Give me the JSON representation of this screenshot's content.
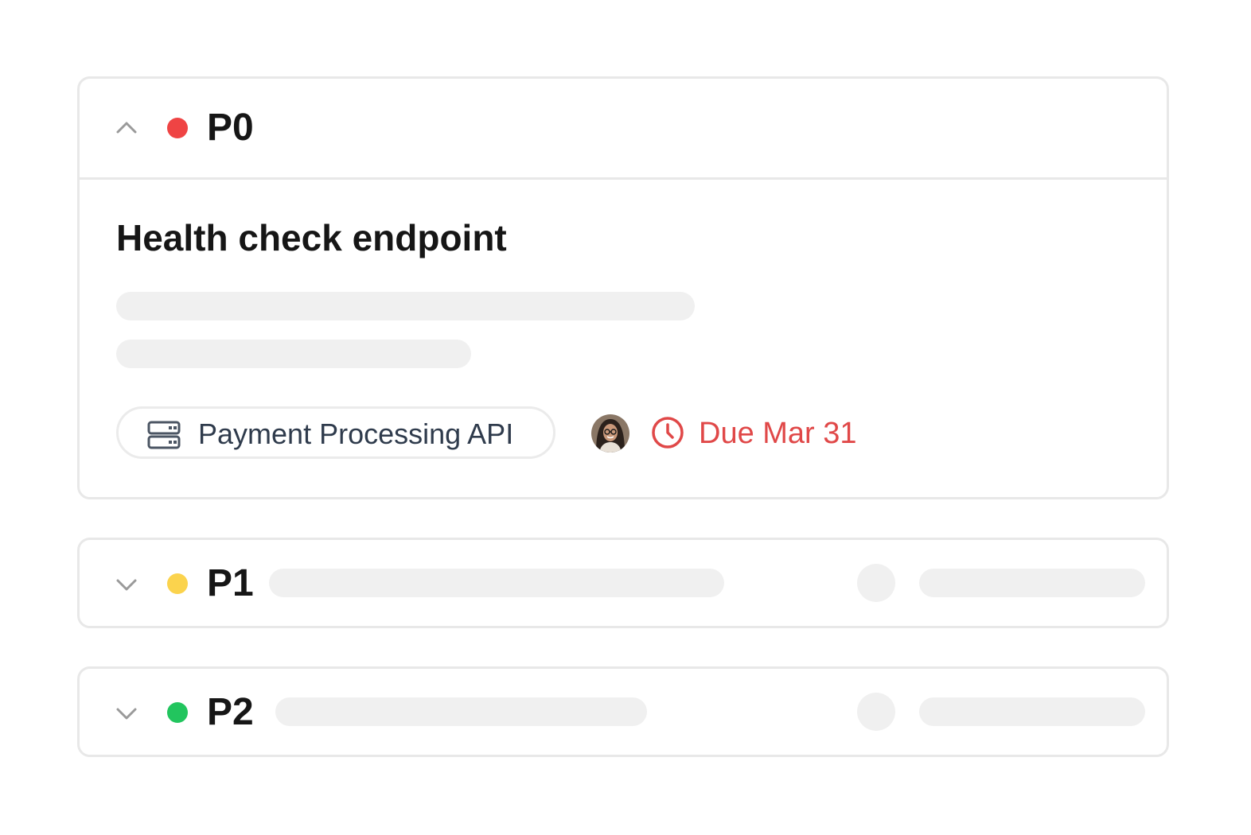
{
  "groups": [
    {
      "priority": "P0",
      "expanded": true,
      "dot_color": "#ef4444",
      "chevron_icon": "chevron-up-icon",
      "task": {
        "title": "Health check endpoint",
        "project": {
          "icon": "server-icon",
          "name": "Payment Processing API"
        },
        "assignee_icon": "avatar",
        "due": {
          "icon": "clock-icon",
          "label": "Due Mar 31",
          "color": "#e04848"
        }
      }
    },
    {
      "priority": "P1",
      "expanded": false,
      "dot_color": "#fbd34d",
      "chevron_icon": "chevron-down-icon"
    },
    {
      "priority": "P2",
      "expanded": false,
      "dot_color": "#22c55e",
      "chevron_icon": "chevron-down-icon"
    }
  ]
}
